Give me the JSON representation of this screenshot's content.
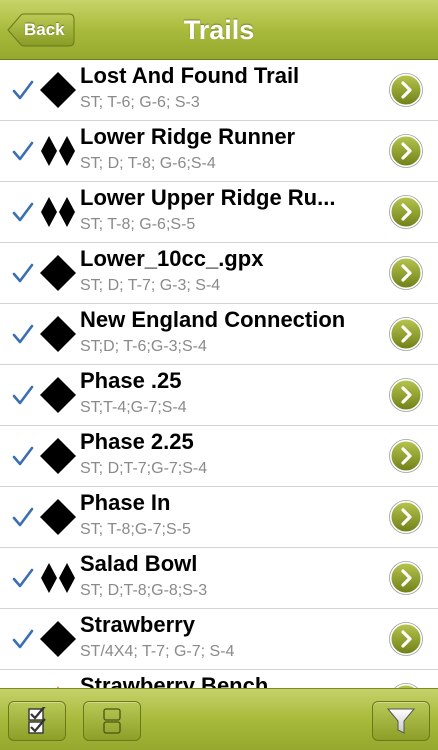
{
  "navbar": {
    "title": "Trails",
    "back_label": "Back"
  },
  "colors": {
    "bar_green": "#a9bb3c",
    "check_blue": "#3b6fb3",
    "chevron_green": "#8b9a2a",
    "orange": "#f28a22"
  },
  "trails": [
    {
      "name": "Lost And Found Trail",
      "details": "ST; T-6; G-6; S-3",
      "difficulty": "black-diamond",
      "checked": true
    },
    {
      "name": "Lower Ridge Runner",
      "details": "ST; D; T-8; G-6;S-4",
      "difficulty": "double-black-diamond",
      "checked": true
    },
    {
      "name": "Lower Upper Ridge Ru...",
      "details": "ST; T-8; G-6;S-5",
      "difficulty": "double-black-diamond",
      "checked": true
    },
    {
      "name": "Lower_10cc_.gpx",
      "details": "ST; D; T-7; G-3; S-4",
      "difficulty": "black-diamond",
      "checked": true
    },
    {
      "name": "New England Connection",
      "details": "ST;D; T-6;G-3;S-4",
      "difficulty": "black-diamond",
      "checked": true
    },
    {
      "name": "Phase .25",
      "details": "ST;T-4;G-7;S-4",
      "difficulty": "black-diamond",
      "checked": true
    },
    {
      "name": "Phase 2.25",
      "details": "ST; D;T-7;G-7;S-4",
      "difficulty": "black-diamond",
      "checked": true
    },
    {
      "name": "Phase In",
      "details": "ST; T-8;G-7;S-5",
      "difficulty": "black-diamond",
      "checked": true
    },
    {
      "name": "Salad Bowl",
      "details": "ST; D;T-8;G-8;S-3",
      "difficulty": "double-black-diamond",
      "checked": true
    },
    {
      "name": "Strawberry",
      "details": "ST/4X4; T-7; G-7; S-4",
      "difficulty": "black-diamond",
      "checked": true
    },
    {
      "name": "Strawberry Bench",
      "details": "",
      "difficulty": "orange-triangle",
      "checked": true
    }
  ],
  "toolbar": {
    "buttons": [
      {
        "icon": "checklist-icon"
      },
      {
        "icon": "split-view-icon"
      },
      {
        "icon": "filter-funnel-icon"
      }
    ]
  }
}
